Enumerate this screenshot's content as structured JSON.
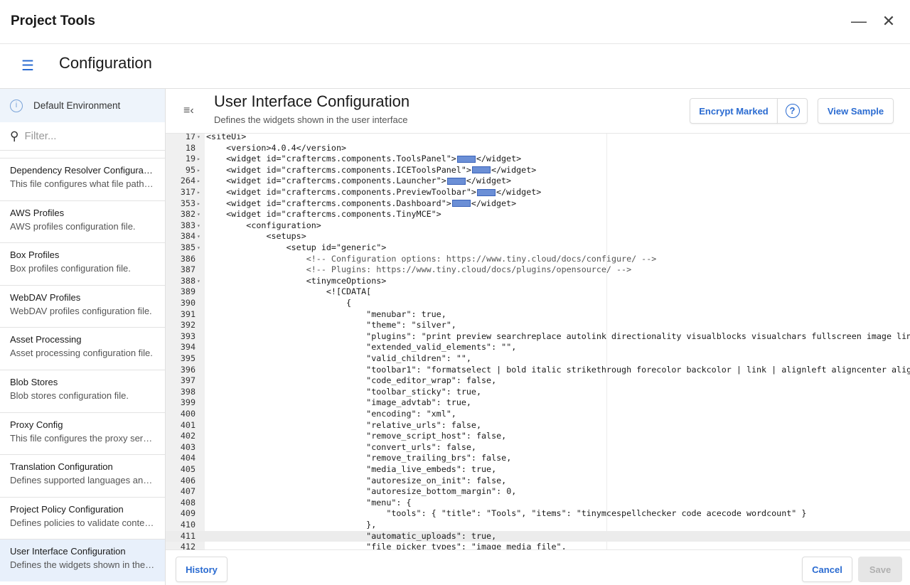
{
  "window": {
    "title": "Project Tools",
    "minimize_icon": "minus-icon",
    "close_icon": "close-icon"
  },
  "subheader": {
    "title": "Configuration",
    "menu_icon": "hamburger-icon"
  },
  "sidebar": {
    "environment": "Default Environment",
    "filter_placeholder": "Filter...",
    "items": [
      {
        "label": "Dependency Resolver Configuration",
        "desc": "This file configures what file paths..."
      },
      {
        "label": "AWS Profiles",
        "desc": "AWS profiles configuration file."
      },
      {
        "label": "Box Profiles",
        "desc": "Box profiles configuration file."
      },
      {
        "label": "WebDAV Profiles",
        "desc": "WebDAV profiles configuration file."
      },
      {
        "label": "Asset Processing",
        "desc": "Asset processing configuration file."
      },
      {
        "label": "Blob Stores",
        "desc": "Blob stores configuration file."
      },
      {
        "label": "Proxy Config",
        "desc": "This file configures the proxy servers..."
      },
      {
        "label": "Translation Configuration",
        "desc": "Defines supported languages and..."
      },
      {
        "label": "Project Policy Configuration",
        "desc": "Defines policies to validate content..."
      },
      {
        "label": "User Interface Configuration",
        "desc": "Defines the widgets shown in the user interface",
        "selected": true
      }
    ]
  },
  "main": {
    "title": "User Interface Configuration",
    "subtitle": "Defines the widgets shown in the user interface",
    "encrypt_label": "Encrypt Marked",
    "view_sample_label": "View Sample",
    "history_label": "History",
    "cancel_label": "Cancel",
    "save_label": "Save",
    "accent": "#2a6bd1"
  },
  "editor": {
    "active_line": 411,
    "lines": [
      {
        "n": "17",
        "arrow": "▾",
        "pre": "<siteUi>"
      },
      {
        "n": "18",
        "arrow": "",
        "pre": "    <version>4.0.4</version>"
      },
      {
        "n": "19",
        "arrow": "▸",
        "pre": "    <widget id=\"craftercms.components.ToolsPanel\">",
        "post": "</widget>",
        "folded": true
      },
      {
        "n": "95",
        "arrow": "▸",
        "pre": "    <widget id=\"craftercms.components.ICEToolsPanel\">",
        "post": "</widget>",
        "folded": true
      },
      {
        "n": "264",
        "arrow": "▸",
        "pre": "    <widget id=\"craftercms.components.Launcher\">",
        "post": "</widget>",
        "folded": true
      },
      {
        "n": "317",
        "arrow": "▸",
        "pre": "    <widget id=\"craftercms.components.PreviewToolbar\">",
        "post": "</widget>",
        "folded": true
      },
      {
        "n": "353",
        "arrow": "▸",
        "pre": "    <widget id=\"craftercms.components.Dashboard\">",
        "post": "</widget>",
        "folded": true
      },
      {
        "n": "382",
        "arrow": "▾",
        "pre": "    <widget id=\"craftercms.components.TinyMCE\">"
      },
      {
        "n": "383",
        "arrow": "▾",
        "pre": "        <configuration>"
      },
      {
        "n": "384",
        "arrow": "▾",
        "pre": "            <setups>"
      },
      {
        "n": "385",
        "arrow": "▾",
        "pre": "                <setup id=\"generic\">"
      },
      {
        "n": "386",
        "arrow": "",
        "pre": "                    <!-- Configuration options: https://www.tiny.cloud/docs/configure/ -->",
        "comment": true
      },
      {
        "n": "387",
        "arrow": "",
        "pre": "                    <!-- Plugins: https://www.tiny.cloud/docs/plugins/opensource/ -->",
        "comment": true
      },
      {
        "n": "388",
        "arrow": "▾",
        "pre": "                    <tinymceOptions>"
      },
      {
        "n": "389",
        "arrow": "",
        "pre": "                        <![CDATA["
      },
      {
        "n": "390",
        "arrow": "",
        "pre": "                            {"
      },
      {
        "n": "391",
        "arrow": "",
        "pre": "                                \"menubar\": true,"
      },
      {
        "n": "392",
        "arrow": "",
        "pre": "                                \"theme\": \"silver\","
      },
      {
        "n": "393",
        "arrow": "",
        "pre": "                                \"plugins\": \"print preview searchreplace autolink directionality visualblocks visualchars fullscreen image lin"
      },
      {
        "n": "394",
        "arrow": "",
        "pre": "                                \"extended_valid_elements\": \"\","
      },
      {
        "n": "395",
        "arrow": "",
        "pre": "                                \"valid_children\": \"\","
      },
      {
        "n": "396",
        "arrow": "",
        "pre": "                                \"toolbar1\": \"formatselect | bold italic strikethrough forecolor backcolor | link | alignleft aligncenter alig"
      },
      {
        "n": "397",
        "arrow": "",
        "pre": "                                \"code_editor_wrap\": false,"
      },
      {
        "n": "398",
        "arrow": "",
        "pre": "                                \"toolbar_sticky\": true,"
      },
      {
        "n": "399",
        "arrow": "",
        "pre": "                                \"image_advtab\": true,"
      },
      {
        "n": "400",
        "arrow": "",
        "pre": "                                \"encoding\": \"xml\","
      },
      {
        "n": "401",
        "arrow": "",
        "pre": "                                \"relative_urls\": false,"
      },
      {
        "n": "402",
        "arrow": "",
        "pre": "                                \"remove_script_host\": false,"
      },
      {
        "n": "403",
        "arrow": "",
        "pre": "                                \"convert_urls\": false,"
      },
      {
        "n": "404",
        "arrow": "",
        "pre": "                                \"remove_trailing_brs\": false,"
      },
      {
        "n": "405",
        "arrow": "",
        "pre": "                                \"media_live_embeds\": true,"
      },
      {
        "n": "406",
        "arrow": "",
        "pre": "                                \"autoresize_on_init\": false,"
      },
      {
        "n": "407",
        "arrow": "",
        "pre": "                                \"autoresize_bottom_margin\": 0,"
      },
      {
        "n": "408",
        "arrow": "",
        "pre": "                                \"menu\": {"
      },
      {
        "n": "409",
        "arrow": "",
        "pre": "                                    \"tools\": { \"title\": \"Tools\", \"items\": \"tinymcespellchecker code acecode wordcount\" }"
      },
      {
        "n": "410",
        "arrow": "",
        "pre": "                                },"
      },
      {
        "n": "411",
        "arrow": "",
        "pre": "                                \"automatic_uploads\": true,"
      },
      {
        "n": "412",
        "arrow": "",
        "pre": "                                \"file_picker_types\": \"image media file\","
      }
    ]
  }
}
